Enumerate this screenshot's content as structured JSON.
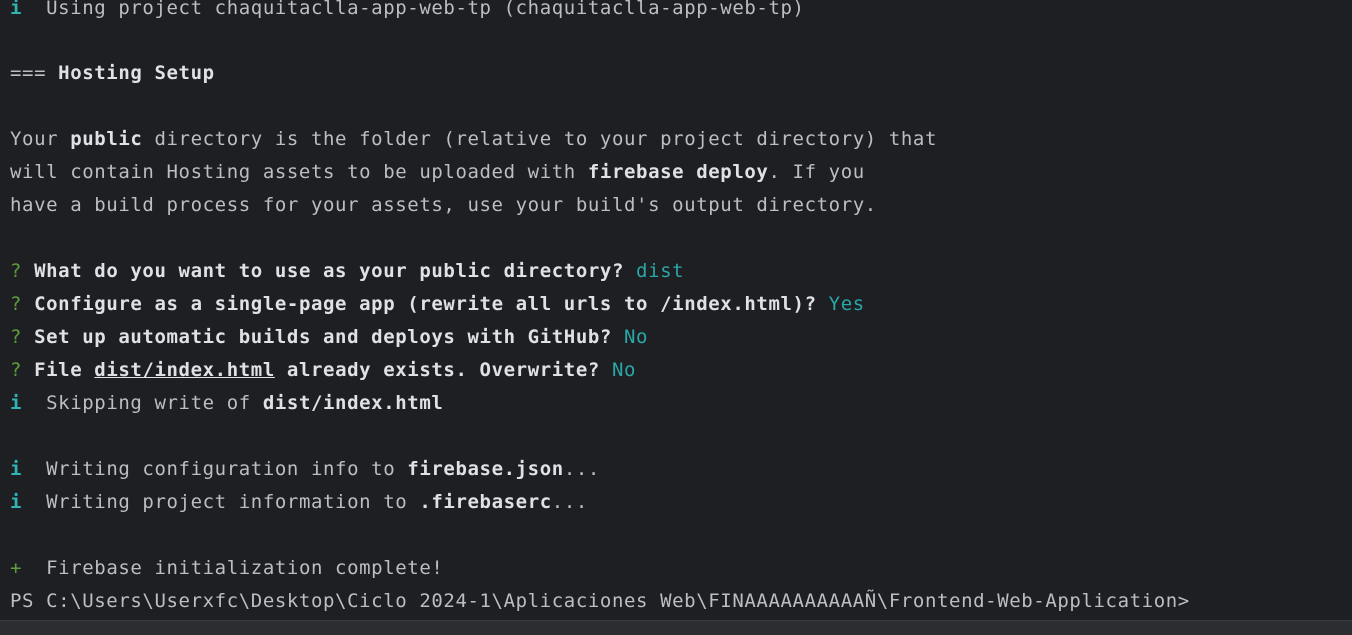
{
  "terminal": {
    "line_using_project": {
      "prefix": "i",
      "text": "  Using project chaquitaclla-app-web-tp (chaquitaclla-app-web-tp)"
    },
    "section_header": {
      "marker": "=== ",
      "title": "Hosting Setup"
    },
    "paragraph": {
      "l1a": "Your ",
      "l1b": "public",
      "l1c": " directory is the folder (relative to your project directory) that",
      "l2a": "will contain Hosting assets to be uploaded with ",
      "l2b": "firebase deploy",
      "l2c": ". If you",
      "l3": "have a build process for your assets, use your build's output directory."
    },
    "questions": [
      {
        "mark": "?",
        "text": " What do you want to use as your public directory?",
        "answer": " dist"
      },
      {
        "mark": "?",
        "text": " Configure as a single-page app (rewrite all urls to /index.html)?",
        "answer": " Yes"
      },
      {
        "mark": "?",
        "text": " Set up automatic builds and deploys with GitHub?",
        "answer": " No"
      }
    ],
    "overwrite_question": {
      "mark": "?",
      "a": " File ",
      "file": "dist/index.html",
      "b": " already exists. Overwrite?",
      "answer": " No"
    },
    "skipping": {
      "prefix": "i",
      "a": "  Skipping write of ",
      "b": "dist/index.html"
    },
    "writing_config": {
      "prefix": "i",
      "a": "  Writing configuration info to ",
      "b": "firebase.json",
      "c": "..."
    },
    "writing_project": {
      "prefix": "i",
      "a": "  Writing project information to ",
      "b": ".firebaserc",
      "c": "..."
    },
    "complete": {
      "prefix": "+",
      "text": "  Firebase initialization complete!"
    },
    "prompt": "PS C:\\Users\\Userxfc\\Desktop\\Ciclo 2024-1\\Aplicaciones Web\\FINAAAAAAAAAAÑ\\Frontend-Web-Application>"
  }
}
